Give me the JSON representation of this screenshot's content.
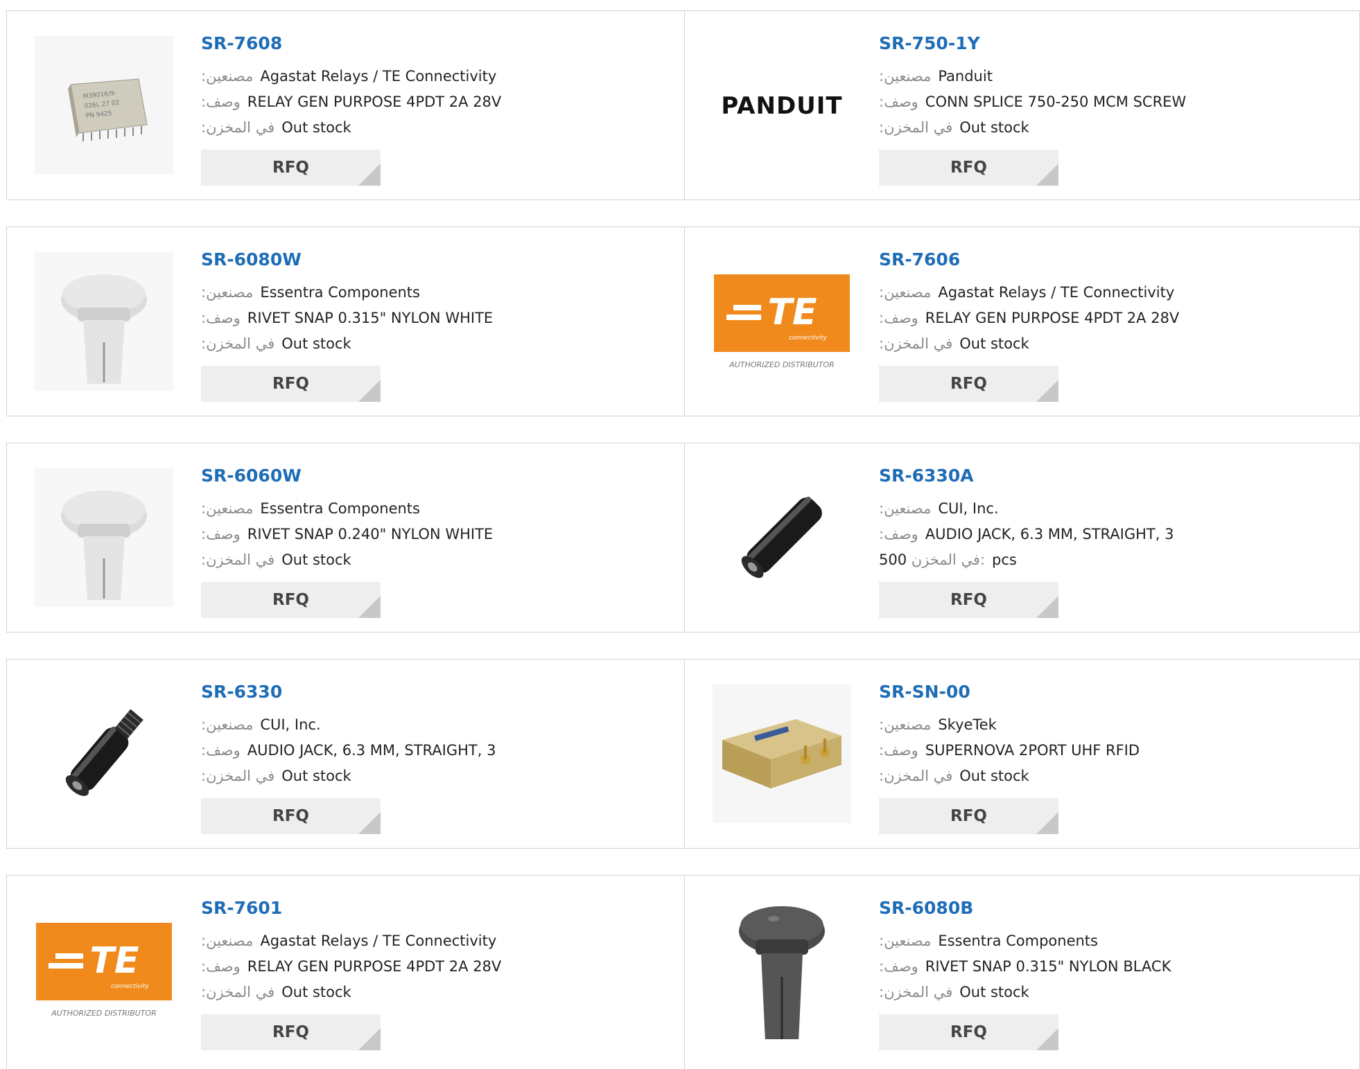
{
  "labels": {
    "manufacturer": ":مصنعين",
    "description": ":وصف",
    "stock": ":في المخزن",
    "stock_inline": "في المخزن:",
    "rfq": "RFQ"
  },
  "products": [
    {
      "part": "SR-7608",
      "manufacturer": "Agastat Relays / TE Connectivity",
      "description": "RELAY GEN PURPOSE 4PDT 2A 28V",
      "stock": "Out stock",
      "image": "relay-image"
    },
    {
      "part": "SR-750-1Y",
      "manufacturer": "Panduit",
      "description": "CONN SPLICE 750-250 MCM SCREW",
      "stock": "Out stock",
      "image": "panduit-logo",
      "logo_text": "PANDUIT"
    },
    {
      "part": "SR-6080W",
      "manufacturer": "Essentra Components",
      "description": "RIVET SNAP 0.315\" NYLON WHITE",
      "stock": "Out stock",
      "image": "white-rivet-image"
    },
    {
      "part": "SR-7606",
      "manufacturer": "Agastat Relays / TE Connectivity",
      "description": "RELAY GEN PURPOSE 4PDT 2A 28V",
      "stock": "Out stock",
      "image": "te-logo",
      "logo_text": "TE",
      "logo_sub": "connectivity",
      "logo_caption": "AUTHORIZED DISTRIBUTOR"
    },
    {
      "part": "SR-6060W",
      "manufacturer": "Essentra Components",
      "description": "RIVET SNAP 0.240\" NYLON WHITE",
      "stock": "Out stock",
      "image": "white-rivet-image"
    },
    {
      "part": "SR-6330A",
      "manufacturer": "CUI, Inc.",
      "description": "AUDIO JACK, 6.3 MM, STRAIGHT, 3",
      "stock_qty": "500",
      "stock_unit": "pcs",
      "image": "audio-jack-image"
    },
    {
      "part": "SR-6330",
      "manufacturer": "CUI, Inc.",
      "description": "AUDIO JACK, 6.3 MM, STRAIGHT, 3",
      "stock": "Out stock",
      "image": "audio-jack-threaded-image"
    },
    {
      "part": "SR-SN-00",
      "manufacturer": "SkyeTek",
      "description": "SUPERNOVA 2PORT UHF RFID",
      "stock": "Out stock",
      "image": "rfid-reader-image"
    },
    {
      "part": "SR-7601",
      "manufacturer": "Agastat Relays / TE Connectivity",
      "description": "RELAY GEN PURPOSE 4PDT 2A 28V",
      "stock": "Out stock",
      "image": "te-logo",
      "logo_text": "TE",
      "logo_sub": "connectivity",
      "logo_caption": "AUTHORIZED DISTRIBUTOR"
    },
    {
      "part": "SR-6080B",
      "manufacturer": "Essentra Components",
      "description": "RIVET SNAP 0.315\" NYLON BLACK",
      "stock": "Out stock",
      "image": "black-rivet-image"
    }
  ],
  "colors": {
    "part_link": "#1f6db6",
    "te_orange": "#f08a1c",
    "border": "#d2d2d2",
    "rfq_bg": "#eeeeee"
  }
}
